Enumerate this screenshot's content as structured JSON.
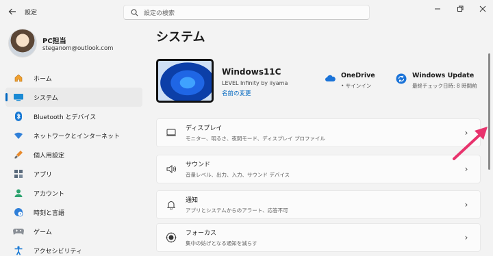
{
  "titlebar": {
    "app_title": "設定",
    "search_placeholder": "設定の検索"
  },
  "profile": {
    "name": "PC担当",
    "email": "steganom@outlook.com"
  },
  "sidebar": {
    "items": [
      {
        "label": "ホーム",
        "icon": "home-icon",
        "selected": false
      },
      {
        "label": "システム",
        "icon": "system-icon",
        "selected": true
      },
      {
        "label": "Bluetooth とデバイス",
        "icon": "bluetooth-icon",
        "selected": false
      },
      {
        "label": "ネットワークとインターネット",
        "icon": "wifi-icon",
        "selected": false
      },
      {
        "label": "個人用設定",
        "icon": "brush-icon",
        "selected": false
      },
      {
        "label": "アプリ",
        "icon": "apps-icon",
        "selected": false
      },
      {
        "label": "アカウント",
        "icon": "account-icon",
        "selected": false
      },
      {
        "label": "時刻と言語",
        "icon": "globe-clock-icon",
        "selected": false
      },
      {
        "label": "ゲーム",
        "icon": "gamepad-icon",
        "selected": false
      },
      {
        "label": "アクセシビリティ",
        "icon": "accessibility-icon",
        "selected": false
      }
    ]
  },
  "main": {
    "page_title": "システム",
    "device": {
      "name": "Windows11C",
      "model": "LEVEL Infinity by iiyama",
      "rename_link": "名前の変更"
    },
    "onedrive": {
      "title": "OneDrive",
      "status": "• サインイン"
    },
    "windows_update": {
      "title": "Windows Update",
      "status": "最終チェック日時: 8 時間前"
    },
    "cards": [
      {
        "title": "ディスプレイ",
        "subtitle": "モニター、明るさ、夜間モード、ディスプレイ プロファイル",
        "icon": "display-icon"
      },
      {
        "title": "サウンド",
        "subtitle": "音量レベル、出力、入力、サウンド デバイス",
        "icon": "speaker-icon"
      },
      {
        "title": "通知",
        "subtitle": "アプリとシステムからのアラート、応答不可",
        "icon": "bell-icon"
      },
      {
        "title": "フォーカス",
        "subtitle": "集中の妨げとなる通知を減らす",
        "icon": "focus-icon"
      }
    ]
  },
  "colors": {
    "accent": "#0067c0",
    "annotation": "#e8336d",
    "background": "#f3f3f3"
  }
}
